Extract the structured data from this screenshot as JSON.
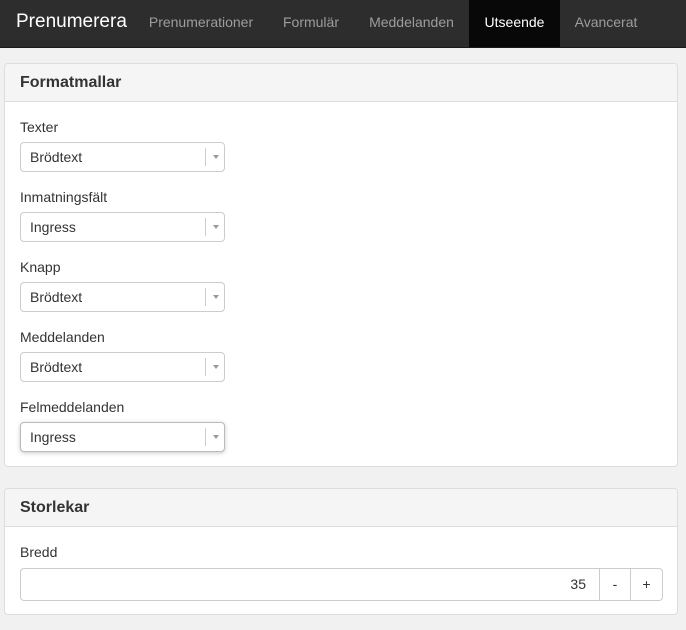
{
  "navbar": {
    "brand": "Prenumerera",
    "items": [
      {
        "label": "Prenumerationer",
        "active": false
      },
      {
        "label": "Formulär",
        "active": false
      },
      {
        "label": "Meddelanden",
        "active": false
      },
      {
        "label": "Utseende",
        "active": true
      },
      {
        "label": "Avancerat",
        "active": false
      }
    ]
  },
  "styles_panel": {
    "title": "Formatmallar",
    "fields": [
      {
        "label": "Texter",
        "value": "Brödtext"
      },
      {
        "label": "Inmatningsfält",
        "value": "Ingress"
      },
      {
        "label": "Knapp",
        "value": "Brödtext"
      },
      {
        "label": "Meddelanden",
        "value": "Brödtext"
      },
      {
        "label": "Felmeddelanden",
        "value": "Ingress"
      }
    ]
  },
  "sizes_panel": {
    "title": "Storlekar",
    "width_label": "Bredd",
    "width_value": "35",
    "decrement_label": "-",
    "increment_label": "+"
  }
}
